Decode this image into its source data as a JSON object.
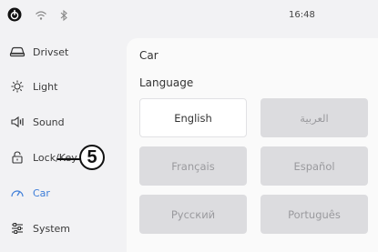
{
  "status_bar": {
    "time": "16:48",
    "icons": [
      "power-icon",
      "wifi-icon",
      "bluetooth-icon"
    ]
  },
  "sidebar": {
    "items": [
      {
        "label": "Drivset",
        "icon": "car-outline-icon",
        "active": false
      },
      {
        "label": "Light",
        "icon": "light-bulb-icon",
        "active": false
      },
      {
        "label": "Sound",
        "icon": "speaker-icon",
        "active": false
      },
      {
        "label": "Lock/Key",
        "icon": "padlock-icon",
        "active": false
      },
      {
        "label": "Car",
        "icon": "speedometer-icon",
        "active": true
      },
      {
        "label": "System",
        "icon": "sliders-icon",
        "active": false
      }
    ],
    "callout_number": "5"
  },
  "main": {
    "title": "Car",
    "section_label": "Language",
    "languages": [
      {
        "label": "English",
        "selected": true
      },
      {
        "label": "العربية",
        "selected": false
      },
      {
        "label": "Français",
        "selected": false
      },
      {
        "label": "Español",
        "selected": false
      },
      {
        "label": "Русский",
        "selected": false
      },
      {
        "label": "Português",
        "selected": false
      }
    ]
  },
  "colors": {
    "accent": "#3d7dd8",
    "background": "#f2f2f4",
    "panel": "#fafafa",
    "button_unselected": "#dcdcdf",
    "button_selected": "#ffffff"
  }
}
